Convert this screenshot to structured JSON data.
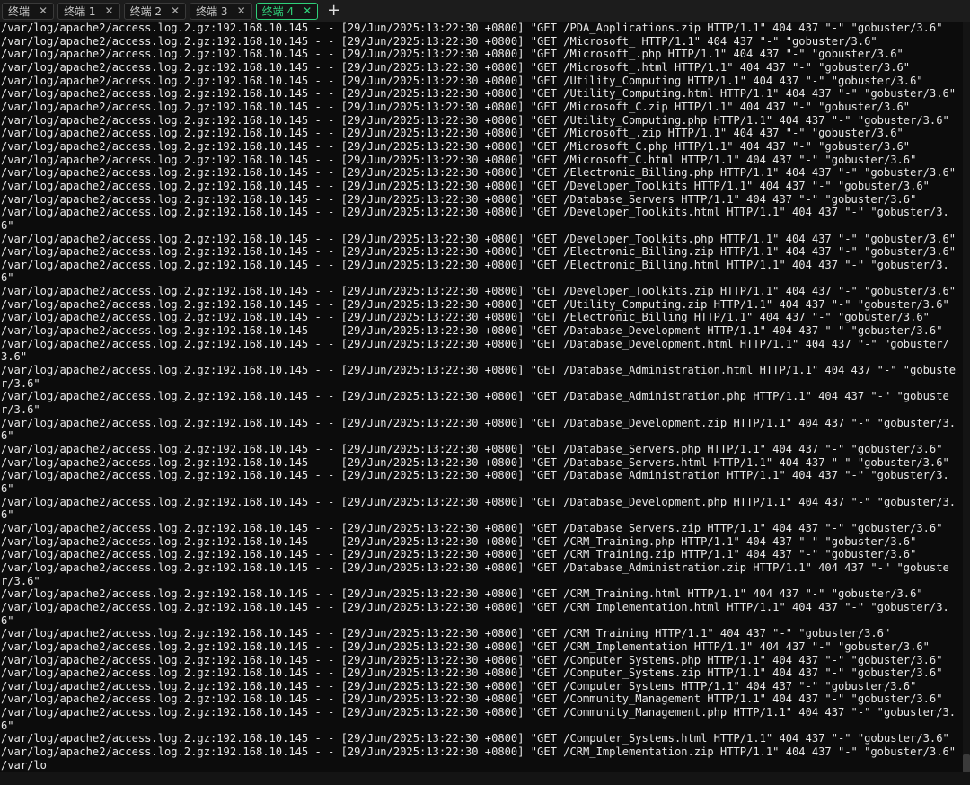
{
  "tabs": [
    {
      "label": "终端"
    },
    {
      "label": "终端 1"
    },
    {
      "label": "终端 2"
    },
    {
      "label": "终端 3"
    },
    {
      "label": "终端 4"
    }
  ],
  "close_glyph": "✕",
  "new_tab_glyph": "+",
  "terminal": {
    "lines": [
      "/var/log/apache2/access.log.2.gz:192.168.10.145 - - [29/Jun/2025:13:22:30 +0800] \"GET /PDA_Applications.zip HTTP/1.1\" 404 437 \"-\" \"gobuster/3.6\"",
      "/var/log/apache2/access.log.2.gz:192.168.10.145 - - [29/Jun/2025:13:22:30 +0800] \"GET /Microsoft_ HTTP/1.1\" 404 437 \"-\" \"gobuster/3.6\"",
      "/var/log/apache2/access.log.2.gz:192.168.10.145 - - [29/Jun/2025:13:22:30 +0800] \"GET /Microsoft_.php HTTP/1.1\" 404 437 \"-\" \"gobuster/3.6\"",
      "/var/log/apache2/access.log.2.gz:192.168.10.145 - - [29/Jun/2025:13:22:30 +0800] \"GET /Microsoft_.html HTTP/1.1\" 404 437 \"-\" \"gobuster/3.6\"",
      "/var/log/apache2/access.log.2.gz:192.168.10.145 - - [29/Jun/2025:13:22:30 +0800] \"GET /Utility_Computing HTTP/1.1\" 404 437 \"-\" \"gobuster/3.6\"",
      "/var/log/apache2/access.log.2.gz:192.168.10.145 - - [29/Jun/2025:13:22:30 +0800] \"GET /Utility_Computing.html HTTP/1.1\" 404 437 \"-\" \"gobuster/3.6\"",
      "/var/log/apache2/access.log.2.gz:192.168.10.145 - - [29/Jun/2025:13:22:30 +0800] \"GET /Microsoft_C.zip HTTP/1.1\" 404 437 \"-\" \"gobuster/3.6\"",
      "/var/log/apache2/access.log.2.gz:192.168.10.145 - - [29/Jun/2025:13:22:30 +0800] \"GET /Utility_Computing.php HTTP/1.1\" 404 437 \"-\" \"gobuster/3.6\"",
      "/var/log/apache2/access.log.2.gz:192.168.10.145 - - [29/Jun/2025:13:22:30 +0800] \"GET /Microsoft_.zip HTTP/1.1\" 404 437 \"-\" \"gobuster/3.6\"",
      "/var/log/apache2/access.log.2.gz:192.168.10.145 - - [29/Jun/2025:13:22:30 +0800] \"GET /Microsoft_C.php HTTP/1.1\" 404 437 \"-\" \"gobuster/3.6\"",
      "/var/log/apache2/access.log.2.gz:192.168.10.145 - - [29/Jun/2025:13:22:30 +0800] \"GET /Microsoft_C.html HTTP/1.1\" 404 437 \"-\" \"gobuster/3.6\"",
      "/var/log/apache2/access.log.2.gz:192.168.10.145 - - [29/Jun/2025:13:22:30 +0800] \"GET /Electronic_Billing.php HTTP/1.1\" 404 437 \"-\" \"gobuster/3.6\"",
      "/var/log/apache2/access.log.2.gz:192.168.10.145 - - [29/Jun/2025:13:22:30 +0800] \"GET /Developer_Toolkits HTTP/1.1\" 404 437 \"-\" \"gobuster/3.6\"",
      "/var/log/apache2/access.log.2.gz:192.168.10.145 - - [29/Jun/2025:13:22:30 +0800] \"GET /Database_Servers HTTP/1.1\" 404 437 \"-\" \"gobuster/3.6\"",
      "/var/log/apache2/access.log.2.gz:192.168.10.145 - - [29/Jun/2025:13:22:30 +0800] \"GET /Developer_Toolkits.html HTTP/1.1\" 404 437 \"-\" \"gobuster/3.6\"",
      "/var/log/apache2/access.log.2.gz:192.168.10.145 - - [29/Jun/2025:13:22:30 +0800] \"GET /Developer_Toolkits.php HTTP/1.1\" 404 437 \"-\" \"gobuster/3.6\"",
      "/var/log/apache2/access.log.2.gz:192.168.10.145 - - [29/Jun/2025:13:22:30 +0800] \"GET /Electronic_Billing.zip HTTP/1.1\" 404 437 \"-\" \"gobuster/3.6\"",
      "/var/log/apache2/access.log.2.gz:192.168.10.145 - - [29/Jun/2025:13:22:30 +0800] \"GET /Electronic_Billing.html HTTP/1.1\" 404 437 \"-\" \"gobuster/3.6\"",
      "/var/log/apache2/access.log.2.gz:192.168.10.145 - - [29/Jun/2025:13:22:30 +0800] \"GET /Developer_Toolkits.zip HTTP/1.1\" 404 437 \"-\" \"gobuster/3.6\"",
      "/var/log/apache2/access.log.2.gz:192.168.10.145 - - [29/Jun/2025:13:22:30 +0800] \"GET /Utility_Computing.zip HTTP/1.1\" 404 437 \"-\" \"gobuster/3.6\"",
      "/var/log/apache2/access.log.2.gz:192.168.10.145 - - [29/Jun/2025:13:22:30 +0800] \"GET /Electronic_Billing HTTP/1.1\" 404 437 \"-\" \"gobuster/3.6\"",
      "/var/log/apache2/access.log.2.gz:192.168.10.145 - - [29/Jun/2025:13:22:30 +0800] \"GET /Database_Development HTTP/1.1\" 404 437 \"-\" \"gobuster/3.6\"",
      "/var/log/apache2/access.log.2.gz:192.168.10.145 - - [29/Jun/2025:13:22:30 +0800] \"GET /Database_Development.html HTTP/1.1\" 404 437 \"-\" \"gobuster/3.6\"",
      "/var/log/apache2/access.log.2.gz:192.168.10.145 - - [29/Jun/2025:13:22:30 +0800] \"GET /Database_Administration.html HTTP/1.1\" 404 437 \"-\" \"gobuster/3.6\"",
      "/var/log/apache2/access.log.2.gz:192.168.10.145 - - [29/Jun/2025:13:22:30 +0800] \"GET /Database_Administration.php HTTP/1.1\" 404 437 \"-\" \"gobuster/3.6\"",
      "/var/log/apache2/access.log.2.gz:192.168.10.145 - - [29/Jun/2025:13:22:30 +0800] \"GET /Database_Development.zip HTTP/1.1\" 404 437 \"-\" \"gobuster/3.6\"",
      "/var/log/apache2/access.log.2.gz:192.168.10.145 - - [29/Jun/2025:13:22:30 +0800] \"GET /Database_Servers.php HTTP/1.1\" 404 437 \"-\" \"gobuster/3.6\"",
      "/var/log/apache2/access.log.2.gz:192.168.10.145 - - [29/Jun/2025:13:22:30 +0800] \"GET /Database_Servers.html HTTP/1.1\" 404 437 \"-\" \"gobuster/3.6\"",
      "/var/log/apache2/access.log.2.gz:192.168.10.145 - - [29/Jun/2025:13:22:30 +0800] \"GET /Database_Administration HTTP/1.1\" 404 437 \"-\" \"gobuster/3.6\"",
      "/var/log/apache2/access.log.2.gz:192.168.10.145 - - [29/Jun/2025:13:22:30 +0800] \"GET /Database_Development.php HTTP/1.1\" 404 437 \"-\" \"gobuster/3.6\"",
      "/var/log/apache2/access.log.2.gz:192.168.10.145 - - [29/Jun/2025:13:22:30 +0800] \"GET /Database_Servers.zip HTTP/1.1\" 404 437 \"-\" \"gobuster/3.6\"",
      "/var/log/apache2/access.log.2.gz:192.168.10.145 - - [29/Jun/2025:13:22:30 +0800] \"GET /CRM_Training.php HTTP/1.1\" 404 437 \"-\" \"gobuster/3.6\"",
      "/var/log/apache2/access.log.2.gz:192.168.10.145 - - [29/Jun/2025:13:22:30 +0800] \"GET /CRM_Training.zip HTTP/1.1\" 404 437 \"-\" \"gobuster/3.6\"",
      "/var/log/apache2/access.log.2.gz:192.168.10.145 - - [29/Jun/2025:13:22:30 +0800] \"GET /Database_Administration.zip HTTP/1.1\" 404 437 \"-\" \"gobuster/3.6\"",
      "/var/log/apache2/access.log.2.gz:192.168.10.145 - - [29/Jun/2025:13:22:30 +0800] \"GET /CRM_Training.html HTTP/1.1\" 404 437 \"-\" \"gobuster/3.6\"",
      "/var/log/apache2/access.log.2.gz:192.168.10.145 - - [29/Jun/2025:13:22:30 +0800] \"GET /CRM_Implementation.html HTTP/1.1\" 404 437 \"-\" \"gobuster/3.6\"",
      "/var/log/apache2/access.log.2.gz:192.168.10.145 - - [29/Jun/2025:13:22:30 +0800] \"GET /CRM_Training HTTP/1.1\" 404 437 \"-\" \"gobuster/3.6\"",
      "/var/log/apache2/access.log.2.gz:192.168.10.145 - - [29/Jun/2025:13:22:30 +0800] \"GET /CRM_Implementation HTTP/1.1\" 404 437 \"-\" \"gobuster/3.6\"",
      "/var/log/apache2/access.log.2.gz:192.168.10.145 - - [29/Jun/2025:13:22:30 +0800] \"GET /Computer_Systems.php HTTP/1.1\" 404 437 \"-\" \"gobuster/3.6\"",
      "/var/log/apache2/access.log.2.gz:192.168.10.145 - - [29/Jun/2025:13:22:30 +0800] \"GET /Computer_Systems.zip HTTP/1.1\" 404 437 \"-\" \"gobuster/3.6\"",
      "/var/log/apache2/access.log.2.gz:192.168.10.145 - - [29/Jun/2025:13:22:30 +0800] \"GET /Computer_Systems HTTP/1.1\" 404 437 \"-\" \"gobuster/3.6\"",
      "/var/log/apache2/access.log.2.gz:192.168.10.145 - - [29/Jun/2025:13:22:30 +0800] \"GET /Community_Management HTTP/1.1\" 404 437 \"-\" \"gobuster/3.6\"",
      "/var/log/apache2/access.log.2.gz:192.168.10.145 - - [29/Jun/2025:13:22:30 +0800] \"GET /Community_Management.php HTTP/1.1\" 404 437 \"-\" \"gobuster/3.6\"",
      "/var/log/apache2/access.log.2.gz:192.168.10.145 - - [29/Jun/2025:13:22:30 +0800] \"GET /Computer_Systems.html HTTP/1.1\" 404 437 \"-\" \"gobuster/3.6\"",
      "/var/log/apache2/access.log.2.gz:192.168.10.145 - - [29/Jun/2025:13:22:30 +0800] \"GET /CRM_Implementation.zip HTTP/1.1\" 404 437 \"-\" \"gobuster/3.6\"",
      "/var/lo"
    ]
  },
  "colors": {
    "background": "#0c0c0c",
    "text": "#e8e8e8",
    "active_tab": "#2fd07a"
  }
}
